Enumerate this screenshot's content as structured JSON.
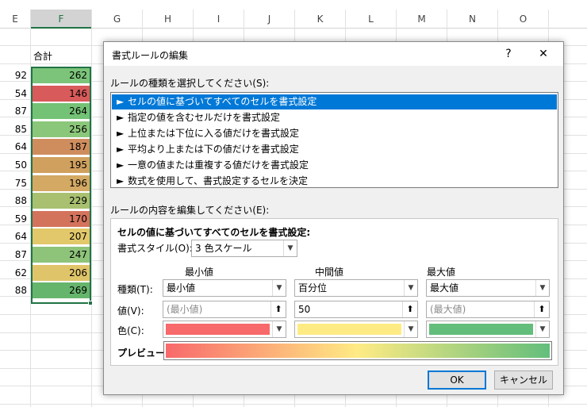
{
  "sheet": {
    "columns": [
      "E",
      "F",
      "G",
      "H",
      "I",
      "J",
      "K",
      "L",
      "M",
      "N",
      "O"
    ],
    "header_e": "",
    "header_f": "合計",
    "e_values": [
      "92",
      "54",
      "87",
      "85",
      "64",
      "50",
      "75",
      "88",
      "59",
      "64",
      "87",
      "62",
      "88"
    ],
    "f_values": [
      "262",
      "146",
      "264",
      "256",
      "187",
      "195",
      "196",
      "229",
      "170",
      "207",
      "247",
      "206",
      "269"
    ],
    "f_colors": [
      "#7cc47a",
      "#d85a5a",
      "#74c275",
      "#8bc77a",
      "#cf8d5e",
      "#d0a05f",
      "#d3a964",
      "#a8c070",
      "#d4735c",
      "#e2c86b",
      "#8ec37a",
      "#e0c46a",
      "#66b56c"
    ]
  },
  "dialog": {
    "title": "書式ルールの編集",
    "help_label": "?",
    "close_label": "✕",
    "rule_type_label": "ルールの種類を選択してください(S):",
    "rule_types": [
      "セルの値に基づいてすべてのセルを書式設定",
      "指定の値を含むセルだけを書式設定",
      "上位または下位に入る値だけを書式設定",
      "平均より上または下の値だけを書式設定",
      "一意の値または重複する値だけを書式設定",
      "数式を使用して、書式設定するセルを決定"
    ],
    "rule_arrow": "►",
    "edit_label": "ルールの内容を編集してください(E):",
    "edit_heading": "セルの値に基づいてすべてのセルを書式設定:",
    "style_label": "書式スタイル(O):",
    "style_value": "3 色スケール",
    "min_header": "最小値",
    "mid_header": "中間値",
    "max_header": "最大値",
    "type_label": "種類(T):",
    "value_label": "値(V):",
    "color_label": "色(C):",
    "min_type": "最小値",
    "mid_type": "百分位",
    "max_type": "最大値",
    "min_value_placeholder": "(最小値)",
    "mid_value": "50",
    "max_value_placeholder": "(最大値)",
    "min_color": "#f8696b",
    "mid_color": "#ffeb84",
    "max_color": "#63be7b",
    "preview_label": "プレビュー:",
    "ok_label": "OK",
    "cancel_label": "キャンセル",
    "dropdown_glyph": "▼",
    "ref_glyph": "⬆"
  }
}
